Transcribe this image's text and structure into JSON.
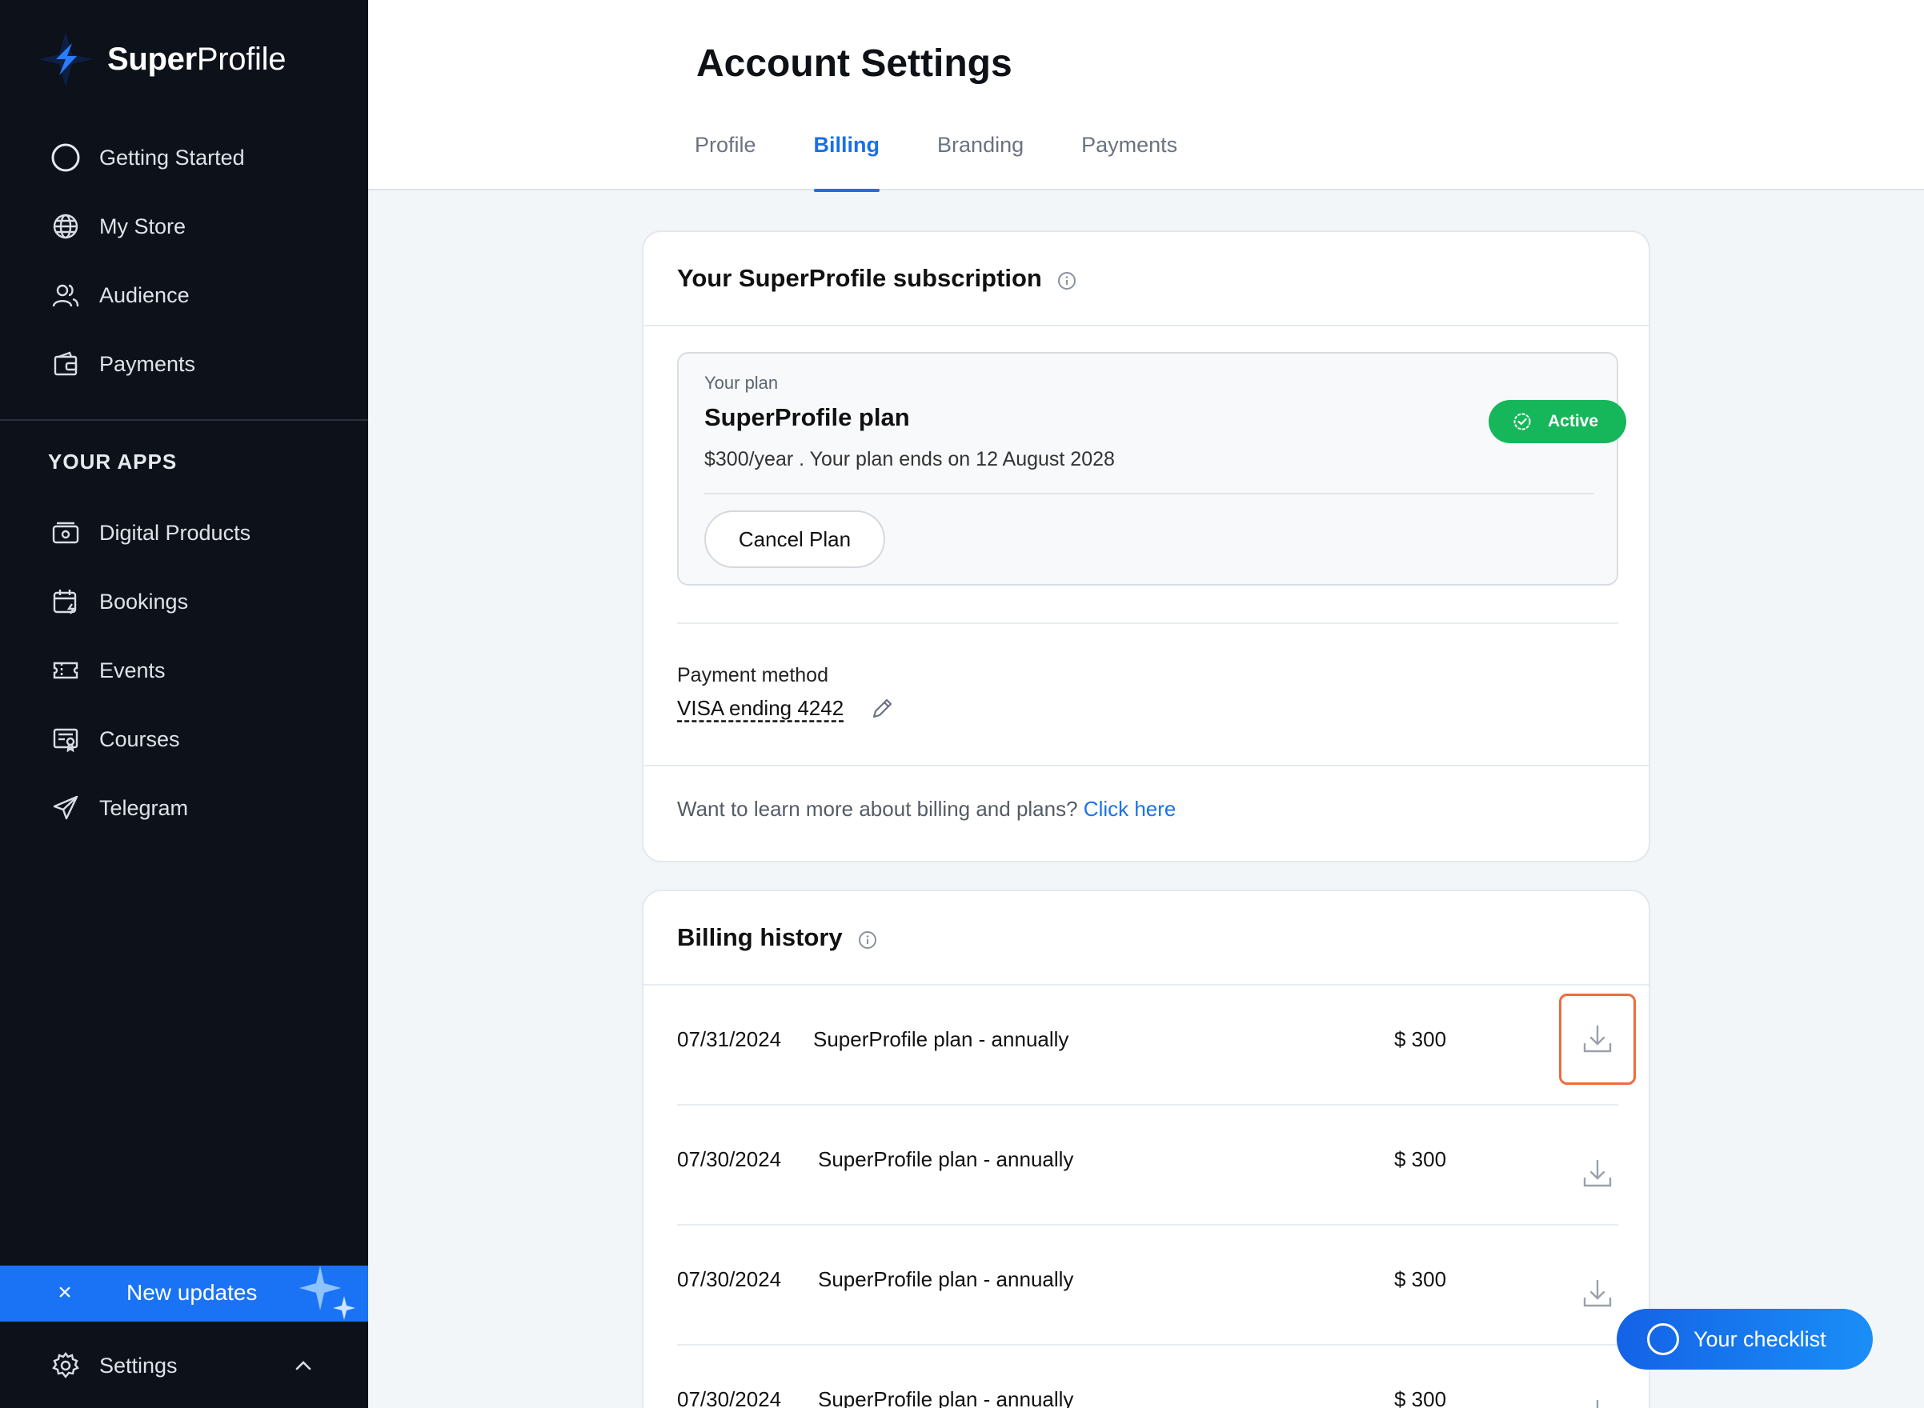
{
  "brand": {
    "name_bold": "Super",
    "name_regular": "Profile"
  },
  "sidebar": {
    "main_items": [
      {
        "label": "Getting Started",
        "icon": "circle-icon"
      },
      {
        "label": "My Store",
        "icon": "globe-icon"
      },
      {
        "label": "Audience",
        "icon": "users-icon"
      },
      {
        "label": "Payments",
        "icon": "wallet-icon"
      }
    ],
    "apps_title": "YOUR APPS",
    "app_items": [
      {
        "label": "Digital Products",
        "icon": "digital-products-icon"
      },
      {
        "label": "Bookings",
        "icon": "calendar-icon"
      },
      {
        "label": "Events",
        "icon": "ticket-icon"
      },
      {
        "label": "Courses",
        "icon": "certificate-icon"
      },
      {
        "label": "Telegram",
        "icon": "send-icon"
      }
    ],
    "updates": {
      "label": "New updates",
      "close": "×"
    },
    "settings": {
      "label": "Settings"
    }
  },
  "header": {
    "title": "Account Settings",
    "tabs": [
      {
        "label": "Profile"
      },
      {
        "label": "Billing"
      },
      {
        "label": "Branding"
      },
      {
        "label": "Payments"
      }
    ],
    "active_tab": "Billing"
  },
  "subscription": {
    "title": "Your SuperProfile subscription",
    "plan_caption": "Your plan",
    "plan_name": "SuperProfile plan",
    "plan_desc": "$300/year . Your plan ends on 12 August 2028",
    "status": "Active",
    "cancel_label": "Cancel Plan",
    "payment_method_label": "Payment method",
    "payment_method_value": "VISA ending 4242",
    "learn_text": "Want to learn more about billing and plans? ",
    "learn_link": "Click here"
  },
  "billing_history": {
    "title": "Billing history",
    "rows": [
      {
        "date": "07/31/2024",
        "desc": "SuperProfile plan - annually",
        "amount": "$ 300"
      },
      {
        "date": "07/30/2024",
        "desc": "SuperProfile plan - annually",
        "amount": "$ 300"
      },
      {
        "date": "07/30/2024",
        "desc": "SuperProfile plan - annually",
        "amount": "$ 300"
      },
      {
        "date": "07/30/2024",
        "desc": "SuperProfile plan - annually",
        "amount": "$ 300"
      }
    ]
  },
  "checklist": {
    "label": "Your checklist"
  },
  "colors": {
    "accent": "#1a6fe8",
    "active_green": "#16b65a",
    "sidebar_bg": "#0c111a",
    "highlight": "#f06b3c"
  }
}
